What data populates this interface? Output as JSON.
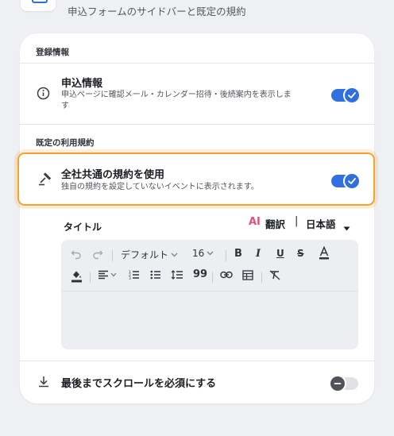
{
  "header": {
    "subtitle": "申込フォームのサイドバーと既定の規約"
  },
  "sections": {
    "registration": "登録情報",
    "terms": "既定の利用規約"
  },
  "application_info": {
    "title": "申込情報",
    "description_line1": "申込ページに確認メール・カレンダー招待・後続案内を表示しま",
    "description_line2": "す",
    "enabled": true
  },
  "common_terms": {
    "title": "全社共通の規約を使用",
    "description": "独自の規約を設定していないイベントに表示されます。",
    "enabled": true
  },
  "editor": {
    "title_label": "タイトル",
    "ai_label": "AI",
    "translate_label": "翻訳",
    "separator": "|",
    "language": "日本語",
    "font_family": "デフォルト",
    "font_size": "16"
  },
  "scroll_required": {
    "title": "最後までスクロールを必須にする",
    "enabled": false
  },
  "colors": {
    "accent": "#2f6fe0",
    "highlight": "#f2a330",
    "ai": "#e4507a"
  }
}
